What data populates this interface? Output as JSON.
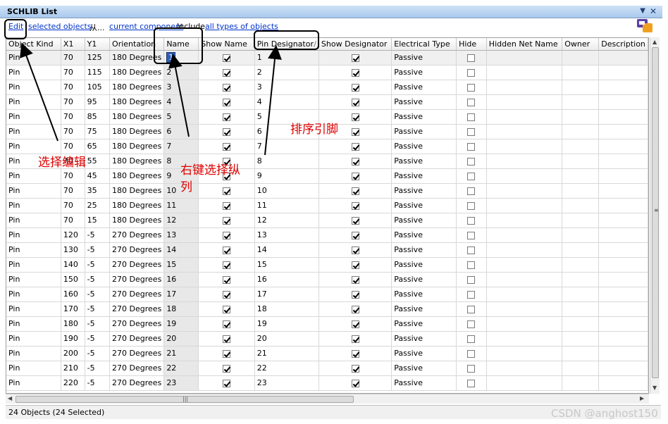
{
  "window": {
    "title": "SCHLIB List"
  },
  "toolbar": {
    "edit": "Edit",
    "selected_objects": "selected objects",
    "from": "从...",
    "current_component": "current component",
    "include": "Include",
    "all_types": "all types of objects"
  },
  "columns": [
    "Object Kind",
    "X1",
    "Y1",
    "Orientation",
    "Name",
    "Show Name",
    "Pin Designator",
    "Show Designator",
    "Electrical Type",
    "Hide",
    "Hidden Net Name",
    "Owner",
    "Description"
  ],
  "sort_indicator": "/",
  "rows": [
    {
      "kind": "Pin",
      "x1": "70",
      "y1": "125",
      "orient": "180 Degrees",
      "name": "1",
      "showname": true,
      "desig": "1",
      "showdesig": true,
      "etype": "Passive",
      "hide": false
    },
    {
      "kind": "Pin",
      "x1": "70",
      "y1": "115",
      "orient": "180 Degrees",
      "name": "2",
      "showname": true,
      "desig": "2",
      "showdesig": true,
      "etype": "Passive",
      "hide": false
    },
    {
      "kind": "Pin",
      "x1": "70",
      "y1": "105",
      "orient": "180 Degrees",
      "name": "3",
      "showname": true,
      "desig": "3",
      "showdesig": true,
      "etype": "Passive",
      "hide": false
    },
    {
      "kind": "Pin",
      "x1": "70",
      "y1": "95",
      "orient": "180 Degrees",
      "name": "4",
      "showname": true,
      "desig": "4",
      "showdesig": true,
      "etype": "Passive",
      "hide": false
    },
    {
      "kind": "Pin",
      "x1": "70",
      "y1": "85",
      "orient": "180 Degrees",
      "name": "5",
      "showname": true,
      "desig": "5",
      "showdesig": true,
      "etype": "Passive",
      "hide": false
    },
    {
      "kind": "Pin",
      "x1": "70",
      "y1": "75",
      "orient": "180 Degrees",
      "name": "6",
      "showname": true,
      "desig": "6",
      "showdesig": true,
      "etype": "Passive",
      "hide": false
    },
    {
      "kind": "Pin",
      "x1": "70",
      "y1": "65",
      "orient": "180 Degrees",
      "name": "7",
      "showname": true,
      "desig": "7",
      "showdesig": true,
      "etype": "Passive",
      "hide": false
    },
    {
      "kind": "Pin",
      "x1": "70",
      "y1": "55",
      "orient": "180 Degrees",
      "name": "8",
      "showname": true,
      "desig": "8",
      "showdesig": true,
      "etype": "Passive",
      "hide": false
    },
    {
      "kind": "Pin",
      "x1": "70",
      "y1": "45",
      "orient": "180 Degrees",
      "name": "9",
      "showname": true,
      "desig": "9",
      "showdesig": true,
      "etype": "Passive",
      "hide": false
    },
    {
      "kind": "Pin",
      "x1": "70",
      "y1": "35",
      "orient": "180 Degrees",
      "name": "10",
      "showname": true,
      "desig": "10",
      "showdesig": true,
      "etype": "Passive",
      "hide": false
    },
    {
      "kind": "Pin",
      "x1": "70",
      "y1": "25",
      "orient": "180 Degrees",
      "name": "11",
      "showname": true,
      "desig": "11",
      "showdesig": true,
      "etype": "Passive",
      "hide": false
    },
    {
      "kind": "Pin",
      "x1": "70",
      "y1": "15",
      "orient": "180 Degrees",
      "name": "12",
      "showname": true,
      "desig": "12",
      "showdesig": true,
      "etype": "Passive",
      "hide": false
    },
    {
      "kind": "Pin",
      "x1": "120",
      "y1": "-5",
      "orient": "270 Degrees",
      "name": "13",
      "showname": true,
      "desig": "13",
      "showdesig": true,
      "etype": "Passive",
      "hide": false
    },
    {
      "kind": "Pin",
      "x1": "130",
      "y1": "-5",
      "orient": "270 Degrees",
      "name": "14",
      "showname": true,
      "desig": "14",
      "showdesig": true,
      "etype": "Passive",
      "hide": false
    },
    {
      "kind": "Pin",
      "x1": "140",
      "y1": "-5",
      "orient": "270 Degrees",
      "name": "15",
      "showname": true,
      "desig": "15",
      "showdesig": true,
      "etype": "Passive",
      "hide": false
    },
    {
      "kind": "Pin",
      "x1": "150",
      "y1": "-5",
      "orient": "270 Degrees",
      "name": "16",
      "showname": true,
      "desig": "16",
      "showdesig": true,
      "etype": "Passive",
      "hide": false
    },
    {
      "kind": "Pin",
      "x1": "160",
      "y1": "-5",
      "orient": "270 Degrees",
      "name": "17",
      "showname": true,
      "desig": "17",
      "showdesig": true,
      "etype": "Passive",
      "hide": false
    },
    {
      "kind": "Pin",
      "x1": "170",
      "y1": "-5",
      "orient": "270 Degrees",
      "name": "18",
      "showname": true,
      "desig": "18",
      "showdesig": true,
      "etype": "Passive",
      "hide": false
    },
    {
      "kind": "Pin",
      "x1": "180",
      "y1": "-5",
      "orient": "270 Degrees",
      "name": "19",
      "showname": true,
      "desig": "19",
      "showdesig": true,
      "etype": "Passive",
      "hide": false
    },
    {
      "kind": "Pin",
      "x1": "190",
      "y1": "-5",
      "orient": "270 Degrees",
      "name": "20",
      "showname": true,
      "desig": "20",
      "showdesig": true,
      "etype": "Passive",
      "hide": false
    },
    {
      "kind": "Pin",
      "x1": "200",
      "y1": "-5",
      "orient": "270 Degrees",
      "name": "21",
      "showname": true,
      "desig": "21",
      "showdesig": true,
      "etype": "Passive",
      "hide": false
    },
    {
      "kind": "Pin",
      "x1": "210",
      "y1": "-5",
      "orient": "270 Degrees",
      "name": "22",
      "showname": true,
      "desig": "22",
      "showdesig": true,
      "etype": "Passive",
      "hide": false
    },
    {
      "kind": "Pin",
      "x1": "220",
      "y1": "-5",
      "orient": "270 Degrees",
      "name": "23",
      "showname": true,
      "desig": "23",
      "showdesig": true,
      "etype": "Passive",
      "hide": false
    }
  ],
  "status": "24 Objects (24 Selected)",
  "annotations": {
    "select_edit": "选择编辑",
    "right_click": "右键选择纵",
    "right_click_2": "列",
    "sort_pins": "排序引脚"
  },
  "watermark": "CSDN @anghost150",
  "colors": {
    "annotation": "#e00000",
    "selection": "#2e5ebd",
    "link": "#0033cc"
  }
}
